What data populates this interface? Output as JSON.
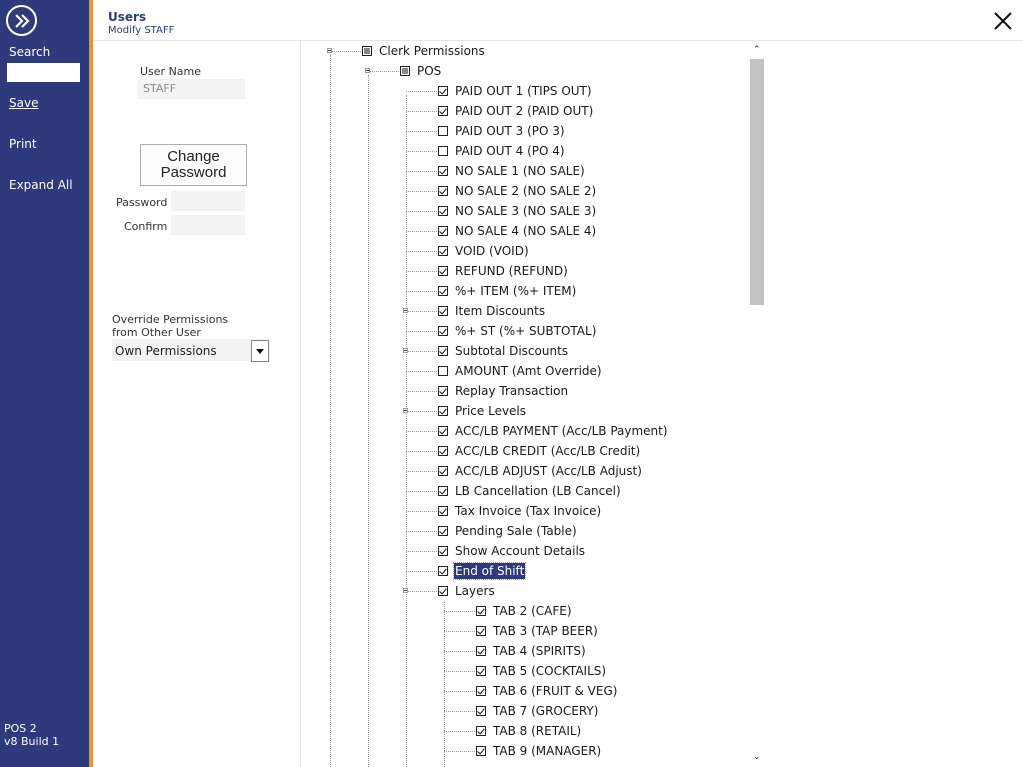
{
  "sidebar": {
    "search_label": "Search",
    "save_label": "Save",
    "print_label": "Print",
    "expand_label": "Expand All",
    "footer_line1": "POS 2",
    "footer_line2": "v8 Build 1",
    "colors": {
      "background": "#2e3a7c",
      "accent": "#e8962a"
    }
  },
  "header": {
    "title": "Users",
    "subtitle": "Modify STAFF"
  },
  "form": {
    "username_label": "User Name",
    "username_value": "STAFF",
    "change_password_line1": "Change",
    "change_password_line2": "Password",
    "password_label": "Password",
    "confirm_label": "Confirm",
    "override_label_line1": "Override Permissions",
    "override_label_line2": "from Other User",
    "override_value": "Own Permissions"
  },
  "tree": {
    "root": {
      "label": "Clerk Permissions",
      "state": "partial"
    },
    "pos": {
      "label": "POS",
      "state": "partial"
    },
    "pos_items": [
      {
        "label": "PAID OUT 1 (TIPS OUT)",
        "checked": true
      },
      {
        "label": "PAID OUT 2 (PAID OUT)",
        "checked": true
      },
      {
        "label": "PAID OUT 3 (PO 3)",
        "checked": false
      },
      {
        "label": "PAID OUT 4 (PO 4)",
        "checked": false
      },
      {
        "label": "NO SALE 1 (NO SALE)",
        "checked": true
      },
      {
        "label": "NO SALE 2 (NO SALE 2)",
        "checked": true
      },
      {
        "label": "NO SALE 3 (NO SALE 3)",
        "checked": true
      },
      {
        "label": "NO SALE 4 (NO SALE 4)",
        "checked": true
      },
      {
        "label": "VOID (VOID)",
        "checked": true
      },
      {
        "label": "REFUND (REFUND)",
        "checked": true
      },
      {
        "label": "%+ ITEM (%+ ITEM)",
        "checked": true
      },
      {
        "label": "Item Discounts",
        "checked": true,
        "collapsed": true
      },
      {
        "label": "%+ ST (%+ SUBTOTAL)",
        "checked": true
      },
      {
        "label": "Subtotal Discounts",
        "checked": true,
        "collapsed": true
      },
      {
        "label": "AMOUNT (Amt Override)",
        "checked": false
      },
      {
        "label": "Replay Transaction",
        "checked": true
      },
      {
        "label": "Price Levels",
        "checked": true,
        "collapsed": true
      },
      {
        "label": "ACC/LB PAYMENT (Acc/LB Payment)",
        "checked": true
      },
      {
        "label": "ACC/LB CREDIT (Acc/LB Credit)",
        "checked": true
      },
      {
        "label": "ACC/LB ADJUST (Acc/LB Adjust)",
        "checked": true
      },
      {
        "label": "LB Cancellation (LB Cancel)",
        "checked": true
      },
      {
        "label": "Tax Invoice (Tax Invoice)",
        "checked": true
      },
      {
        "label": "Pending Sale (Table)",
        "checked": true
      },
      {
        "label": "Show Account Details",
        "checked": true
      },
      {
        "label": "End of Shift",
        "checked": true,
        "selected": true
      },
      {
        "label": "Layers",
        "checked": true,
        "expanded": true
      }
    ],
    "layer_items": [
      {
        "label": "TAB 2 (CAFE)",
        "checked": true
      },
      {
        "label": "TAB 3 (TAP BEER)",
        "checked": true
      },
      {
        "label": "TAB 4 (SPIRITS)",
        "checked": true
      },
      {
        "label": "TAB 5 (COCKTAILS)",
        "checked": true
      },
      {
        "label": "TAB 6 (FRUIT & VEG)",
        "checked": true
      },
      {
        "label": "TAB 7 (GROCERY)",
        "checked": true
      },
      {
        "label": "TAB 8 (RETAIL)",
        "checked": true
      },
      {
        "label": "TAB 9 (MANAGER)",
        "checked": true
      }
    ]
  },
  "icons": {
    "logo": "forward-icon",
    "close": "close-icon",
    "dropdown": "chevron-down-icon",
    "scroll_up": "chevron-up-icon",
    "scroll_down": "chevron-down-icon"
  },
  "scrollbar": {
    "up_glyph": "⌃",
    "down_glyph": "⌄"
  }
}
